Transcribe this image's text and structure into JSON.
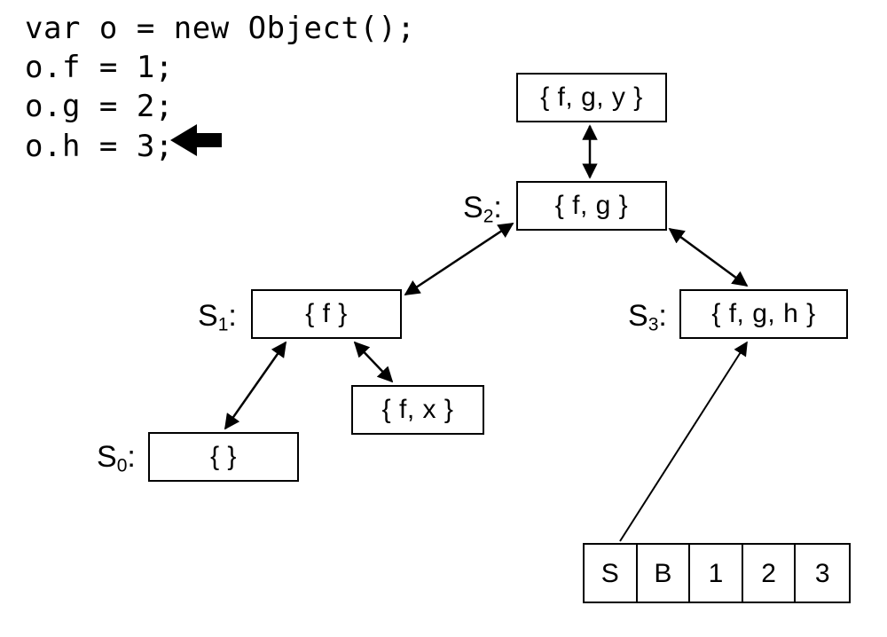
{
  "code": {
    "lines": [
      "var o = new Object();",
      "o.f = 1;",
      "o.g = 2;",
      "o.h = 3;"
    ],
    "arrow_after_line_index": 3
  },
  "nodes": {
    "s0": {
      "label_prefix": "S",
      "label_sub": "0",
      "content": "{ }"
    },
    "s1": {
      "label_prefix": "S",
      "label_sub": "1",
      "content": "{ f }"
    },
    "s2": {
      "label_prefix": "S",
      "label_sub": "2",
      "content": "{ f, g }"
    },
    "s3": {
      "label_prefix": "S",
      "label_sub": "3",
      "content": "{ f, g, h }"
    },
    "fx": {
      "content": "{ f, x }"
    },
    "fgy": {
      "content": "{ f, g, y }"
    }
  },
  "table": {
    "cells": [
      "S",
      "B",
      "1",
      "2",
      "3"
    ]
  },
  "chart_data": {
    "type": "diagram",
    "title": "",
    "description": "JavaScript hidden-class / structure-transition graph",
    "code_sequence": [
      "var o = new Object();",
      "o.f = 1;",
      "o.g = 2;",
      "o.h = 3;"
    ],
    "current_line_index": 3,
    "structures": [
      {
        "id": "S0",
        "fields": []
      },
      {
        "id": "S1",
        "fields": [
          "f"
        ]
      },
      {
        "id": "S2",
        "fields": [
          "f",
          "g"
        ]
      },
      {
        "id": "S3",
        "fields": [
          "f",
          "g",
          "h"
        ]
      },
      {
        "id": "fx",
        "fields": [
          "f",
          "x"
        ]
      },
      {
        "id": "fgy",
        "fields": [
          "f",
          "g",
          "y"
        ]
      }
    ],
    "edges_bidirectional": [
      [
        "S0",
        "S1"
      ],
      [
        "S1",
        "fx"
      ],
      [
        "S1",
        "S2"
      ],
      [
        "S2",
        "fgy"
      ],
      [
        "S2",
        "S3"
      ]
    ],
    "object_record_cells": [
      "S",
      "B",
      "1",
      "2",
      "3"
    ],
    "object_record_points_to": "S3"
  }
}
